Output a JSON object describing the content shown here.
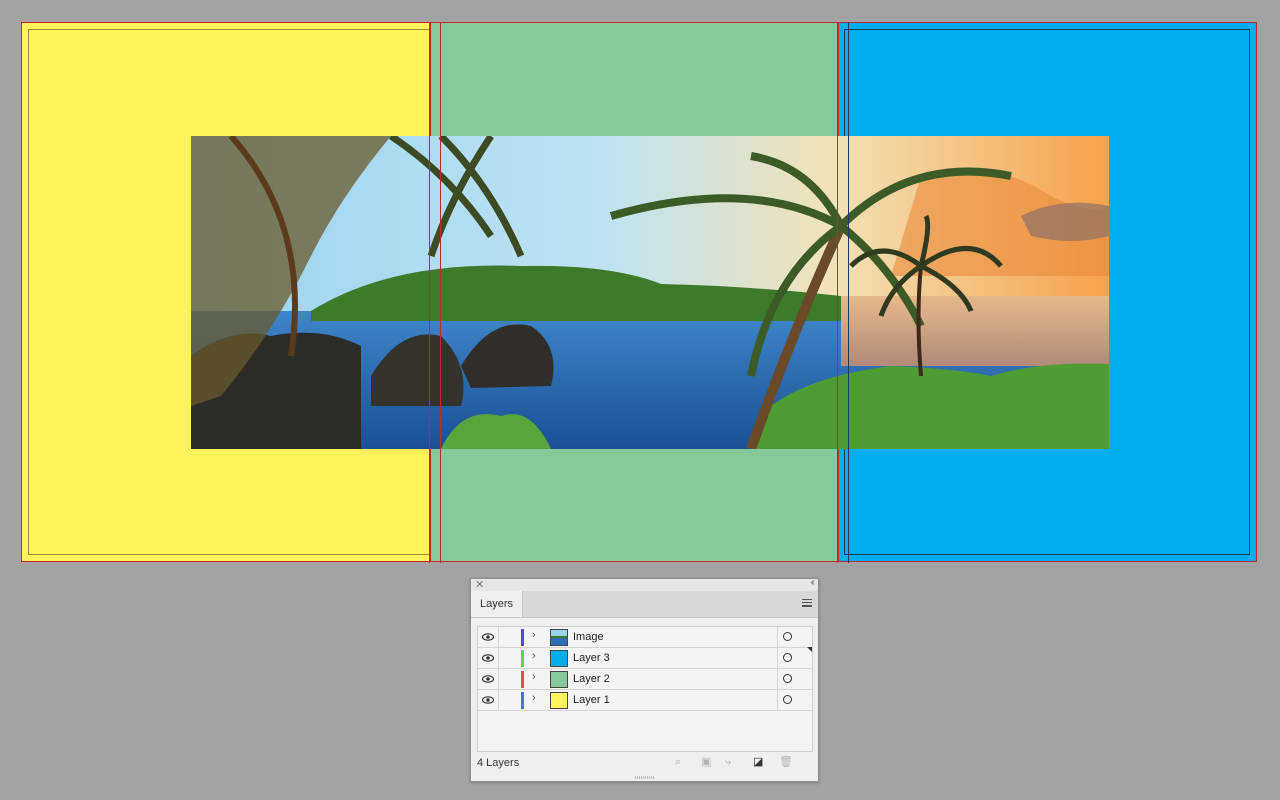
{
  "colors": {
    "canvas_bg": "#a3a3a3",
    "artboard_1": "#fff35c",
    "artboard_2": "#86c898",
    "artboard_3": "#00adef",
    "bleed_guide": "#c0282d"
  },
  "layers_panel": {
    "tab_label": "Layers",
    "layer_count": "4 Layers",
    "layers": [
      {
        "name": "Image",
        "color": "#4a4ae0",
        "thumb": "photo"
      },
      {
        "name": "Layer 3",
        "color": "#4fdc4f",
        "thumb": "#00adef"
      },
      {
        "name": "Layer 2",
        "color": "#e84a4a",
        "thumb": "#86c898"
      },
      {
        "name": "Layer 1",
        "color": "#4a6ee0",
        "thumb": "#fff35c"
      }
    ],
    "icons": [
      "close-icon",
      "collapse-icon",
      "panel-menu-icon",
      "eye-icon",
      "chevron-right-icon",
      "target-icon",
      "locate-object-icon",
      "make-clipping-mask-icon",
      "create-sublayer-icon",
      "create-layer-icon",
      "delete-icon"
    ]
  }
}
